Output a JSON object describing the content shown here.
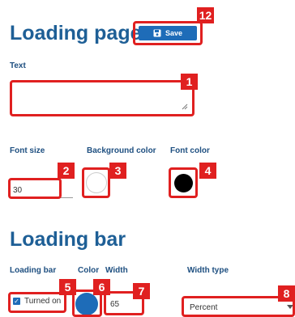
{
  "loading_page": {
    "title": "Loading page",
    "save_label": "Save",
    "text_label": "Text",
    "text_value": "",
    "font_size_label": "Font size",
    "font_size_value": "30",
    "background_color_label": "Background color",
    "background_color": "#ffffff",
    "font_color_label": "Font color",
    "font_color": "#000000"
  },
  "loading_bar": {
    "title": "Loading bar",
    "loading_bar_label": "Loading bar",
    "turned_on_label": "Turned on",
    "turned_on_checked": true,
    "color_label": "Color",
    "color": "#1e6cb8",
    "width_label": "Width",
    "width_value": "65",
    "width_type_label": "Width type",
    "width_type_value": "Percent"
  },
  "callouts": {
    "text": "1",
    "font_size": "2",
    "background_color": "3",
    "font_color": "4",
    "turned_on": "5",
    "bar_color": "6",
    "width": "7",
    "width_type": "8",
    "save": "12"
  },
  "colors": {
    "heading": "#1e5f96",
    "label": "#1e4f80",
    "accent": "#1e6cb8",
    "callout": "#e02020"
  },
  "icons": {
    "save": "floppy-disk-icon",
    "checkbox": "check-icon",
    "dropdown": "chevron-down-icon",
    "resize": "resize-handle-icon"
  }
}
